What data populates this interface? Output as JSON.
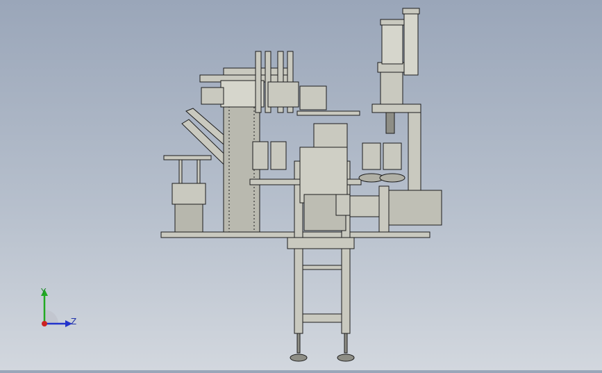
{
  "viewport": {
    "colors": {
      "background_top": "#9aa6b9",
      "background_bottom": "#d2d7de",
      "part_fill": "#c9c9bf",
      "part_dark": "#8e8e86",
      "edge_line": "#1c1c1c"
    }
  },
  "triad": {
    "y_label": "Y",
    "z_label": "Z",
    "colors": {
      "y": "#22aa22",
      "z": "#2233cc",
      "x": "#cc2222"
    }
  }
}
